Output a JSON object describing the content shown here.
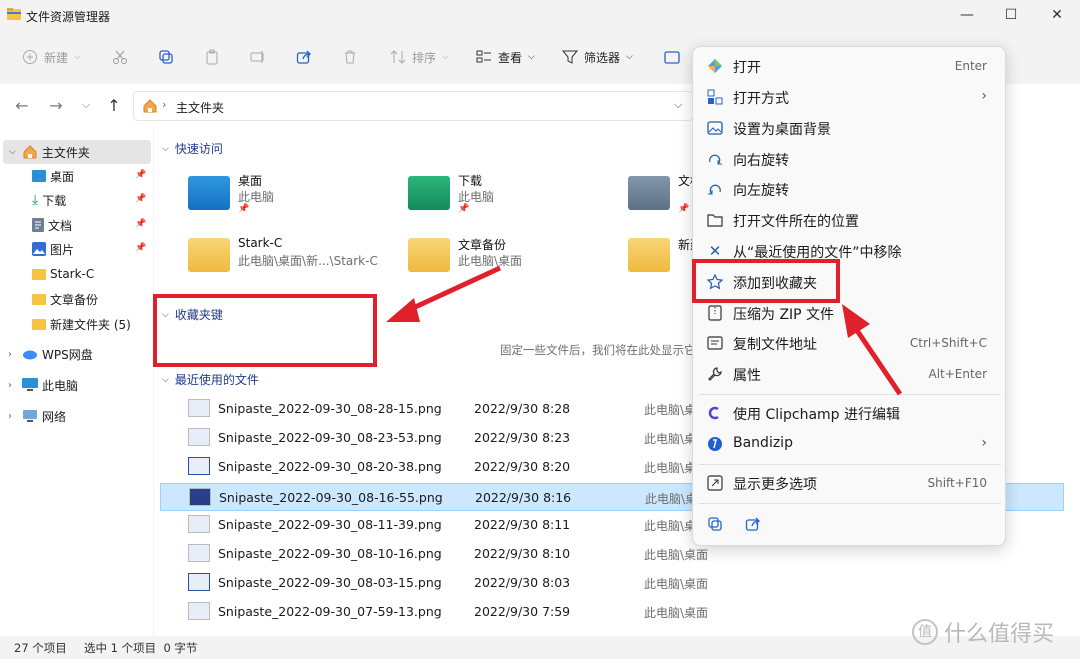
{
  "window": {
    "title": "文件资源管理器"
  },
  "toolbar": {
    "new_label": "新建",
    "sort_label": "排序",
    "view_label": "查看",
    "filter_label": "筛选器"
  },
  "address": {
    "crumb": "主文件夹"
  },
  "sidebar": {
    "home": "主文件夹",
    "items": [
      {
        "label": "桌面"
      },
      {
        "label": "下载"
      },
      {
        "label": "文档"
      },
      {
        "label": "图片"
      },
      {
        "label": "Stark-C"
      },
      {
        "label": "文章备份"
      },
      {
        "label": "新建文件夹 (5)"
      }
    ],
    "wps": "WPS网盘",
    "pc": "此电脑",
    "network": "网络"
  },
  "quick_access": {
    "title": "快速访问",
    "items": [
      {
        "name": "桌面",
        "sub": "此电脑"
      },
      {
        "name": "下载",
        "sub": "此电脑"
      },
      {
        "name": "文档",
        "sub": "此电脑"
      },
      {
        "name": "Stark-C",
        "sub": "此电脑\\桌面\\新...\\Stark-C"
      },
      {
        "name": "文章备份",
        "sub": "此电脑\\桌面"
      },
      {
        "name": "新建",
        "sub": ""
      }
    ]
  },
  "favorites": {
    "title": "收藏夹键",
    "empty_hint": "固定一些文件后，我们将在此处显示它"
  },
  "recent": {
    "title": "最近使用的文件",
    "files": [
      {
        "name": "Snipaste_2022-09-30_08-28-15.png",
        "date": "2022/9/30 8:28",
        "loc": "此电脑\\桌"
      },
      {
        "name": "Snipaste_2022-09-30_08-23-53.png",
        "date": "2022/9/30 8:23",
        "loc": "此电脑\\桌"
      },
      {
        "name": "Snipaste_2022-09-30_08-20-38.png",
        "date": "2022/9/30 8:20",
        "loc": "此电脑\\桌"
      },
      {
        "name": "Snipaste_2022-09-30_08-16-55.png",
        "date": "2022/9/30 8:16",
        "loc": "此电脑\\桌"
      },
      {
        "name": "Snipaste_2022-09-30_08-11-39.png",
        "date": "2022/9/30 8:11",
        "loc": "此电脑\\桌面"
      },
      {
        "name": "Snipaste_2022-09-30_08-10-16.png",
        "date": "2022/9/30 8:10",
        "loc": "此电脑\\桌面"
      },
      {
        "name": "Snipaste_2022-09-30_08-03-15.png",
        "date": "2022/9/30 8:03",
        "loc": "此电脑\\桌面"
      },
      {
        "name": "Snipaste_2022-09-30_07-59-13.png",
        "date": "2022/9/30 7:59",
        "loc": "此电脑\\桌面"
      }
    ]
  },
  "status": {
    "count": "27 个项目",
    "selected": "选中 1 个项目  0 字节"
  },
  "context_menu": {
    "items": [
      {
        "label": "打开",
        "key": "Enter",
        "icon": "photos-icon"
      },
      {
        "label": "打开方式",
        "key": "",
        "icon": "open-with-icon"
      },
      {
        "label": "设置为桌面背景",
        "key": "",
        "icon": "wallpaper-icon"
      },
      {
        "label": "向右旋转",
        "key": "",
        "icon": "rotate-right-icon"
      },
      {
        "label": "向左旋转",
        "key": "",
        "icon": "rotate-left-icon"
      },
      {
        "label": "打开文件所在的位置",
        "key": "",
        "icon": "folder-icon"
      },
      {
        "label": "从“最近使用的文件”中移除",
        "key": "",
        "icon": "remove-icon"
      },
      {
        "label": "添加到收藏夹",
        "key": "",
        "icon": "star-icon"
      },
      {
        "label": "压缩为 ZIP 文件",
        "key": "",
        "icon": "zip-icon"
      },
      {
        "label": "复制文件地址",
        "key": "Ctrl+Shift+C",
        "icon": "copy-path-icon"
      },
      {
        "label": "属性",
        "key": "Alt+Enter",
        "icon": "wrench-icon"
      },
      {
        "label": "使用 Clipchamp 进行编辑",
        "key": "",
        "icon": "clipchamp-icon"
      },
      {
        "label": "Bandizip",
        "key": "",
        "icon": "bandizip-icon"
      },
      {
        "label": "显示更多选项",
        "key": "Shift+F10",
        "icon": "more-options-icon"
      }
    ]
  },
  "watermark": {
    "text": "什么值得买"
  },
  "colors": {
    "accent": "#0067c0",
    "selection": "#cce8ff",
    "highlight_red": "#e0202a"
  }
}
